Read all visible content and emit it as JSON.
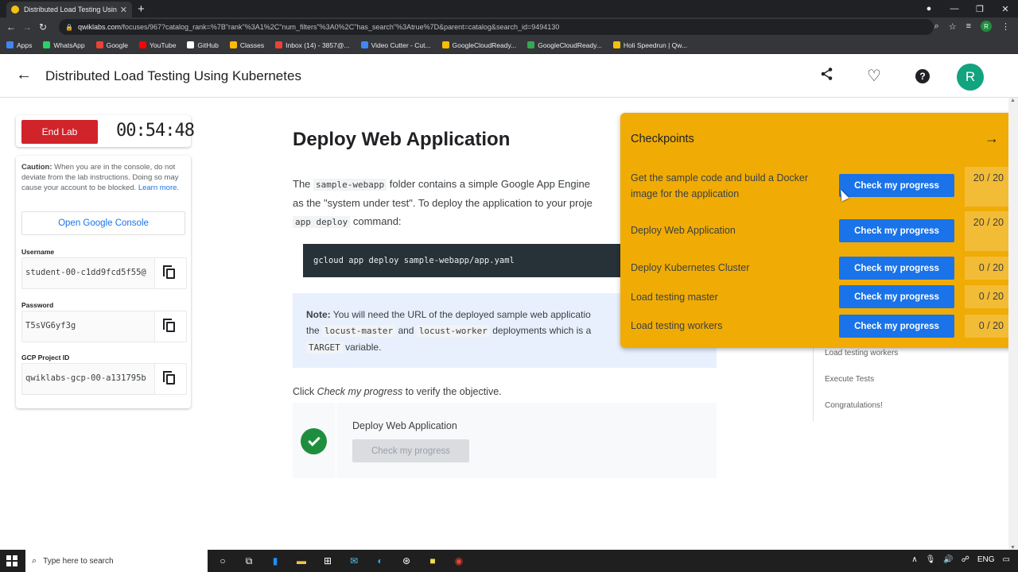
{
  "browser": {
    "tab_title": "Distributed Load Testing Using K",
    "tab_close": "✕",
    "new_tab": "+",
    "url_domain": "qwiklabs.com",
    "url_path": "/focuses/967?catalog_rank=%7B\"rank\"%3A1%2C\"num_filters\"%3A0%2C\"has_search\"%3Atrue%7D&parent=catalog&search_id=9494130",
    "profile_initial": "R",
    "bookmarks": [
      {
        "label": "Apps",
        "color": "#4285f4"
      },
      {
        "label": "WhatsApp",
        "color": "#25d366"
      },
      {
        "label": "Google",
        "color": "#ea4335"
      },
      {
        "label": "YouTube",
        "color": "#ff0000"
      },
      {
        "label": "GitHub",
        "color": "#ffffff"
      },
      {
        "label": "Classes",
        "color": "#fbbc04"
      },
      {
        "label": "Inbox (14) - 3857@...",
        "color": "#ea4335"
      },
      {
        "label": "Video Cutter - Cut...",
        "color": "#4285f4"
      },
      {
        "label": "GoogleCloudReady...",
        "color": "#fbbc04"
      },
      {
        "label": "GoogleCloudReady...",
        "color": "#34a853"
      },
      {
        "label": "Holi Speedrun | Qw...",
        "color": "#f4c20d"
      }
    ]
  },
  "header": {
    "title": "Distributed Load Testing Using Kubernetes",
    "avatar_initial": "R"
  },
  "lab": {
    "end_label": "End Lab",
    "timer": "00:54:48",
    "caution_bold": "Caution:",
    "caution_text": " When you are in the console, do not deviate from the lab instructions. Doing so may cause your account to be blocked. ",
    "learn_more": "Learn more.",
    "open_console": "Open Google Console",
    "username_label": "Username",
    "username_value": "student-00-c1dd9fcd5f55@",
    "password_label": "Password",
    "password_value": "T5sVG6yf3g",
    "project_label": "GCP Project ID",
    "project_value": "qwiklabs-gcp-00-a131795b"
  },
  "main": {
    "heading": "Deploy Web Application",
    "p1": "The ",
    "p1_code": "sample-webapp",
    "p2": " folder contains a simple Google App Engine",
    "p3": "as the \"system under test\". To deploy the application to your proje",
    "p4_code": "app deploy",
    "p4": " command:",
    "code": "gcloud app deploy sample-webapp/app.yaml",
    "note_bold": "Note:",
    "note1": " You will need the URL of the deployed sample web applicatio",
    "note2": "the ",
    "note_code1": "locust-master",
    "note3": " and ",
    "note_code2": "locust-worker",
    "note4": " deployments which is a",
    "note_code3": "TARGET",
    "note5": " variable.",
    "click_pre": "Click ",
    "click_em": "Check my progress",
    "click_post": " to verify the objective.",
    "cp_title": "Deploy Web Application",
    "cp_button": "Check my progress"
  },
  "toc": [
    "Load testing workers",
    "Execute Tests",
    "Congratulations!"
  ],
  "checkpoints": {
    "title": "Checkpoints",
    "items": [
      {
        "label": "Get the sample code and build a Docker image for the application",
        "button": "Check my progress",
        "score": "20 / 20"
      },
      {
        "label": "Deploy Web Application",
        "button": "Check my progress",
        "score": "20 / 20"
      },
      {
        "label": "Deploy Kubernetes Cluster",
        "button": "Check my progress",
        "score": "0 / 20"
      },
      {
        "label": "Load testing master",
        "button": "Check my progress",
        "score": "0 / 20"
      },
      {
        "label": "Load testing workers",
        "button": "Check my progress",
        "score": "0 / 20"
      }
    ]
  },
  "taskbar": {
    "search_placeholder": "Type here to search",
    "lang": "ENG"
  }
}
